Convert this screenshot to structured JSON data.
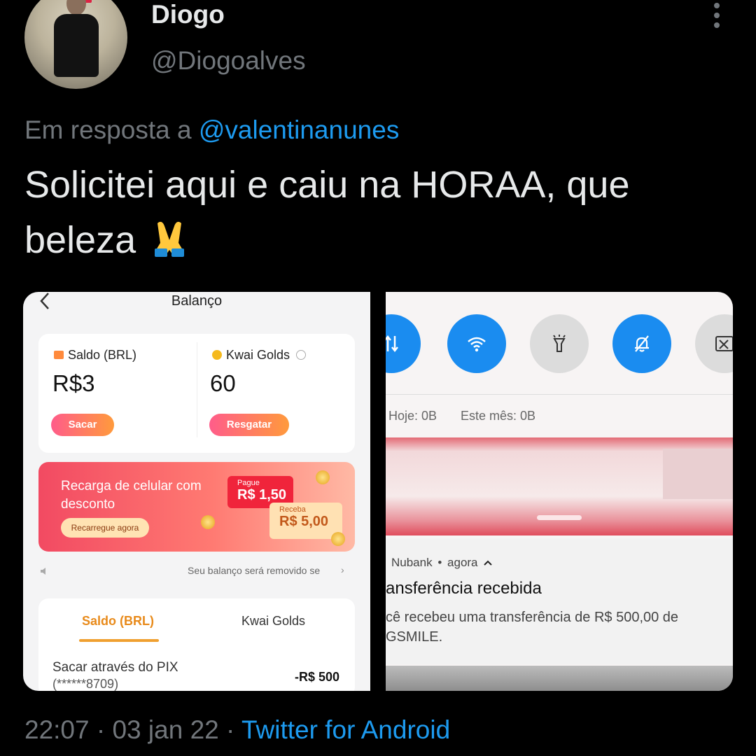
{
  "user": {
    "name": "Diogo",
    "handle": "@Diogoalves"
  },
  "reply": {
    "prefix": "Em resposta a",
    "mention": "@valentinanunes"
  },
  "tweet": {
    "text": "Solicitei aqui e caiu na HORAA, que beleza",
    "emoji": "🙏"
  },
  "footer": {
    "time": "22:07",
    "sep1": "·",
    "date": "03 jan 22",
    "sep2": "·",
    "source": "Twitter for Android"
  },
  "left_screen": {
    "title": "Balanço",
    "saldo_label": "Saldo (BRL)",
    "saldo_value": "R$3",
    "saldo_button": "Sacar",
    "golds_label": "Kwai Golds",
    "golds_value": "60",
    "golds_button": "Resgatar",
    "promo_text": "Recarga de celular com desconto",
    "promo_button": "Recarregue agora",
    "pay_label": "Pague",
    "pay_value": "R$ 1,50",
    "get_label": "Receba",
    "get_value": "R$ 5,00",
    "notice": "Seu balanço será removido se",
    "tab_saldo": "Saldo (BRL)",
    "tab_golds": "Kwai Golds",
    "tx_title": "Sacar através do PIX",
    "tx_account": "(******8709)",
    "tx_amount": "-R$ 500"
  },
  "right_screen": {
    "data_today": "Hoje: 0B",
    "data_month": "Este mês: 0B",
    "notif_app": "Nubank",
    "notif_dot": "•",
    "notif_time": "agora",
    "notif_title": "ansferência recebida",
    "notif_body_1": "cê recebeu uma transferência de R$ 500,00 de",
    "notif_body_2": "GSMILE."
  },
  "colors": {
    "accent": "#1d9bf0",
    "muted": "#71767b",
    "qs_blue": "#1a8cf0",
    "qs_gray": "#dcdcdc",
    "kwai_gradient_start": "#ff5c8a",
    "kwai_gradient_end": "#ff9a3c"
  }
}
